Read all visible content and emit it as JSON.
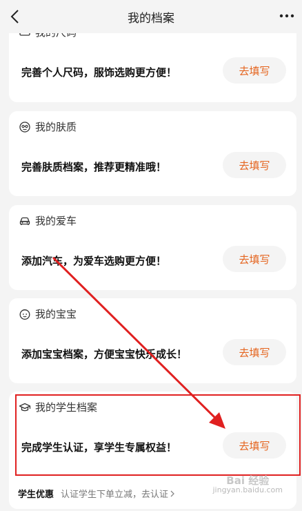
{
  "header": {
    "title": "我的档案"
  },
  "cards": [
    {
      "title": "我的尺码",
      "desc": "完善个人尺码，服饰选购更方便！",
      "button": "去填写",
      "icon": "ruler-icon"
    },
    {
      "title": "我的肤质",
      "desc": "完善肤质档案，推荐更精准哦！",
      "button": "去填写",
      "icon": "face-icon"
    },
    {
      "title": "我的爱车",
      "desc": "添加汽车，为爱车选购更方便！",
      "button": "去填写",
      "icon": "car-icon"
    },
    {
      "title": "我的宝宝",
      "desc": "添加宝宝档案，方便宝宝快乐成长！",
      "button": "去填写",
      "icon": "baby-icon"
    },
    {
      "title": "我的学生档案",
      "desc": "完成学生认证，享学生专属权益！",
      "button": "去填写",
      "icon": "graduation-cap-icon"
    }
  ],
  "footer": {
    "title": "学生优惠",
    "link": "认证学生下单立减，去认证"
  },
  "watermark": {
    "main": "Bai 经验",
    "sub": "jingyan.baidu.com"
  },
  "colors": {
    "accent": "#e5641e",
    "annotation": "#e02020",
    "background": "#f4f4f4"
  }
}
